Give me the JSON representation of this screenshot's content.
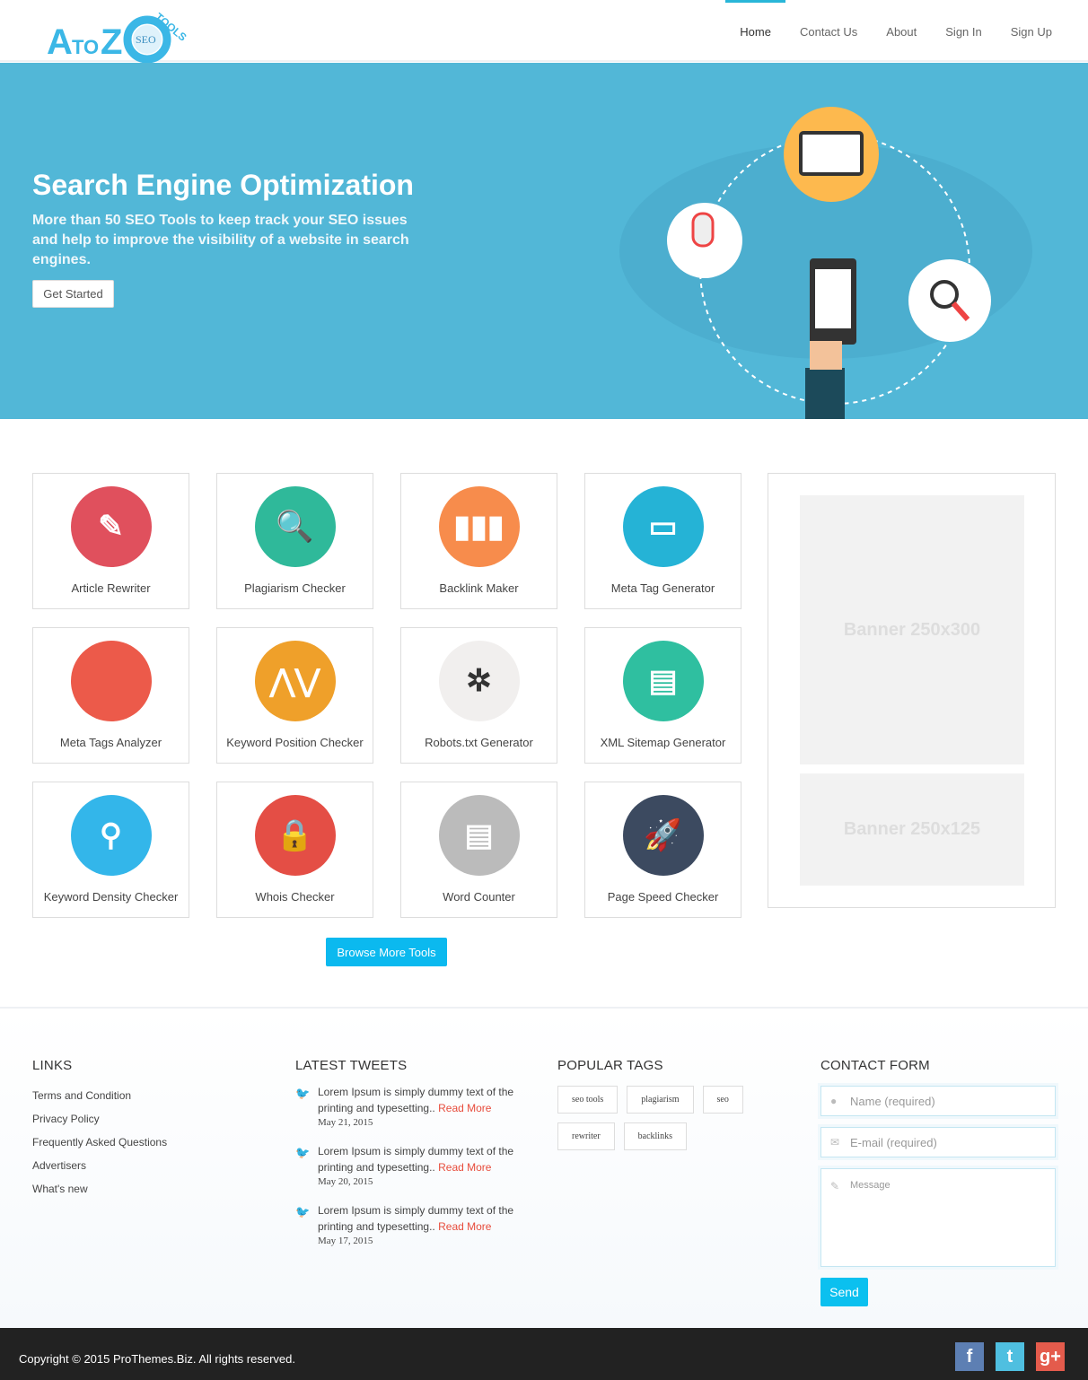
{
  "header": {
    "logo_text": "AtoZ SEO Tools",
    "nav": [
      {
        "label": "Home",
        "active": true
      },
      {
        "label": "Contact Us"
      },
      {
        "label": "About"
      },
      {
        "label": "Sign In"
      },
      {
        "label": "Sign Up"
      }
    ]
  },
  "hero": {
    "title": "Search Engine Optimization",
    "subtitle": "More than 50 SEO Tools to keep track your SEO issues and help to improve the visibility of a website in search engines.",
    "button": "Get Started",
    "bg": "#52b7d7"
  },
  "tools": [
    {
      "label": "Article Rewriter",
      "color": "#e0505d",
      "glyph": "✎"
    },
    {
      "label": "Plagiarism Checker",
      "color": "#2fb99a",
      "glyph": "🔍"
    },
    {
      "label": "Backlink Maker",
      "color": "#f78c4c",
      "glyph": "▮▮▮"
    },
    {
      "label": "Meta Tag Generator",
      "color": "#25b3d6",
      "glyph": "▭"
    },
    {
      "label": "Meta Tags Analyzer",
      "color": "#ec5a4a",
      "glyph": "</>"
    },
    {
      "label": "Keyword Position Checker",
      "color": "#efa02a",
      "glyph": "⋀⋁"
    },
    {
      "label": "Robots.txt Generator",
      "color": "#f1efee",
      "glyph": "✲"
    },
    {
      "label": "XML Sitemap Generator",
      "color": "#2fbfa0",
      "glyph": "▤"
    },
    {
      "label": "Keyword Density Checker",
      "color": "#33b6ea",
      "glyph": "⚲"
    },
    {
      "label": "Whois Checker",
      "color": "#e44e45",
      "glyph": "🔒"
    },
    {
      "label": "Word Counter",
      "color": "#bbbbbb",
      "glyph": "▤"
    },
    {
      "label": "Page Speed Checker",
      "color": "#3c4a60",
      "glyph": "🚀"
    }
  ],
  "browse_button": "Browse More Tools",
  "banners": {
    "large": "Banner  250x300",
    "small": "Banner  250x125"
  },
  "footer": {
    "links_title": "LINKS",
    "links": [
      "Terms and Condition",
      "Privacy Policy",
      "Frequently Asked Questions",
      "Advertisers",
      "What's new"
    ],
    "tweets_title": "LATEST TWEETS",
    "tweets": [
      {
        "text": "Lorem Ipsum is simply dummy text of the printing and typesetting..",
        "more": "Read More",
        "date": "May 21, 2015"
      },
      {
        "text": "Lorem Ipsum is simply dummy text of the printing and typesetting..",
        "more": "Read More",
        "date": "May 20, 2015"
      },
      {
        "text": "Lorem Ipsum is simply dummy text of the printing and typesetting..",
        "more": "Read More",
        "date": "May 17, 2015"
      }
    ],
    "tags_title": "POPULAR TAGS",
    "tags": [
      "seo tools",
      "plagiarism",
      "seo",
      "rewriter",
      "backlinks"
    ],
    "contact_title": "CONTACT FORM",
    "name_placeholder": "Name (required)",
    "email_placeholder": "E-mail (required)",
    "message_placeholder": "Message",
    "send": "Send"
  },
  "bottom": {
    "copyright": "Copyright © 2015 ProThemes.Biz. All rights reserved.",
    "social": [
      {
        "name": "facebook",
        "glyph": "f",
        "color": "#5d7fb3"
      },
      {
        "name": "twitter",
        "glyph": "t",
        "color": "#4fbfe0"
      },
      {
        "name": "google-plus",
        "glyph": "g+",
        "color": "#e45b4c"
      }
    ]
  }
}
